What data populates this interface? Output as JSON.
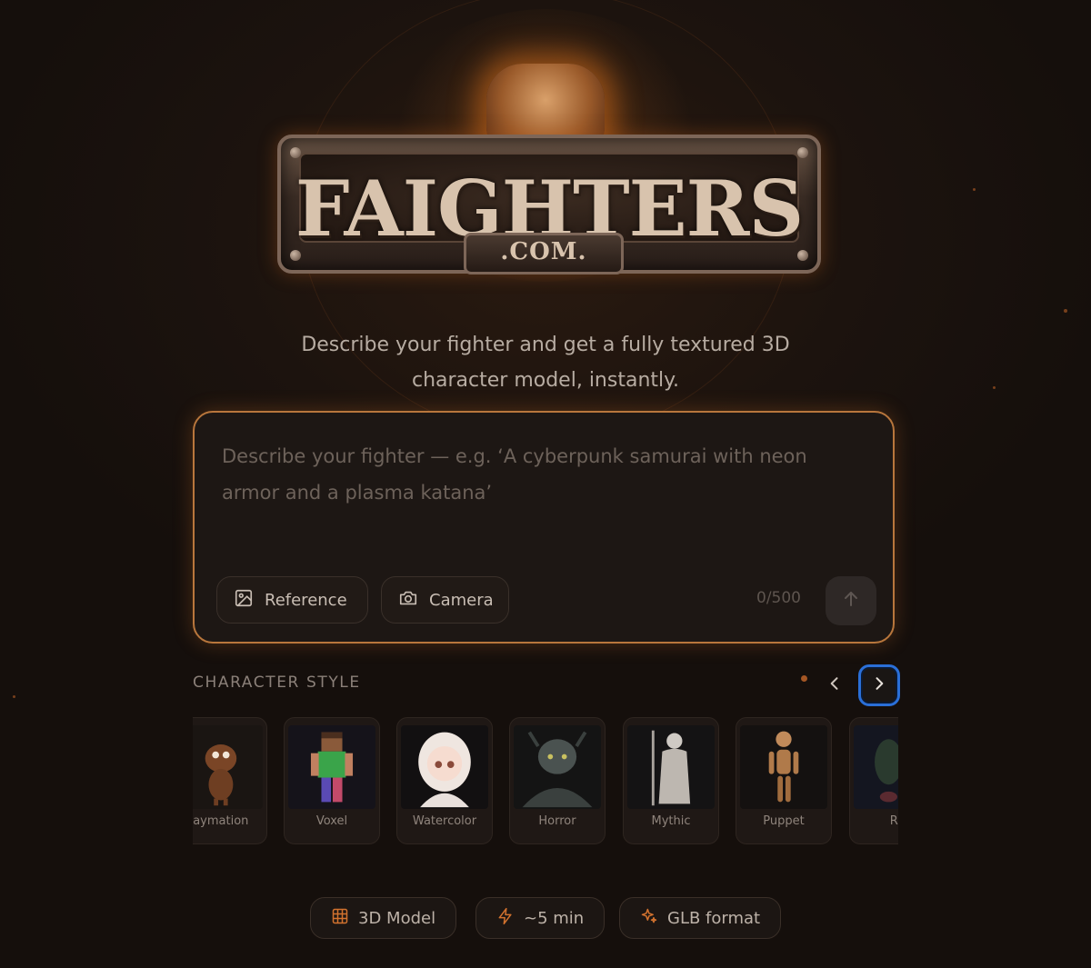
{
  "logo": {
    "word": "FAIGHTERS",
    "sub": ".COM."
  },
  "tagline": "Describe your fighter and get a fully textured 3D character model, instantly.",
  "prompt": {
    "value": "",
    "placeholder": "Describe your fighter — e.g. ‘A cyberpunk samurai with neon armor and a plasma katana’",
    "reference_label": "Reference",
    "reference_icon": "image-icon",
    "camera_label": "Camera",
    "camera_icon": "camera-icon",
    "counter": "0/500",
    "send_icon": "arrow-up-icon"
  },
  "character_style": {
    "label": "CHARACTER STYLE",
    "prev_icon": "chevron-left-icon",
    "next_icon": "chevron-right-icon",
    "items": [
      {
        "label": "laymation"
      },
      {
        "label": "Voxel"
      },
      {
        "label": "Watercolor"
      },
      {
        "label": "Horror"
      },
      {
        "label": "Mythic"
      },
      {
        "label": "Puppet"
      },
      {
        "label": "Re"
      }
    ]
  },
  "badges": [
    {
      "label": "3D Model",
      "icon": "grid-icon"
    },
    {
      "label": "~5 min",
      "icon": "lightning-icon"
    },
    {
      "label": "GLB format",
      "icon": "sparkles-icon"
    }
  ],
  "colors": {
    "accent": "#c8682a",
    "focus_ring": "#2a6fd8",
    "background": "#1c130e"
  }
}
